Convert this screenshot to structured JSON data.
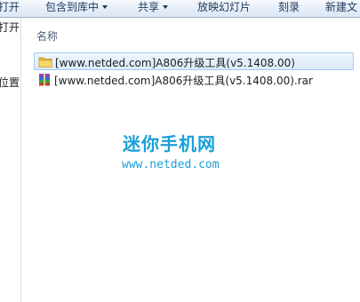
{
  "toolbar": {
    "items": [
      {
        "label": "打开"
      },
      {
        "label": "包含到库中",
        "has_dropdown": true
      },
      {
        "label": "共享",
        "has_dropdown": true
      },
      {
        "label": "放映幻灯片"
      },
      {
        "label": "刻录"
      },
      {
        "label": "新建文"
      }
    ]
  },
  "nav": {
    "items": [
      {
        "label": "打开"
      },
      {
        "label": "位置"
      }
    ]
  },
  "file_list": {
    "column_header": "名称",
    "files": [
      {
        "name": "[www.netded.com]A806升级工具(v5.1408.00)",
        "type": "folder",
        "selected": true
      },
      {
        "name": "[www.netded.com]A806升级工具(v5.1408.00).rar",
        "type": "rar-archive",
        "selected": false
      }
    ]
  },
  "watermark": {
    "title": "迷你手机网",
    "url": "www.netded.com",
    "color": "#19a0d8"
  },
  "colors": {
    "toolbar_text": "#1e395b",
    "selection_border": "#a6c9f0",
    "folder_yellow": "#f2c744"
  }
}
